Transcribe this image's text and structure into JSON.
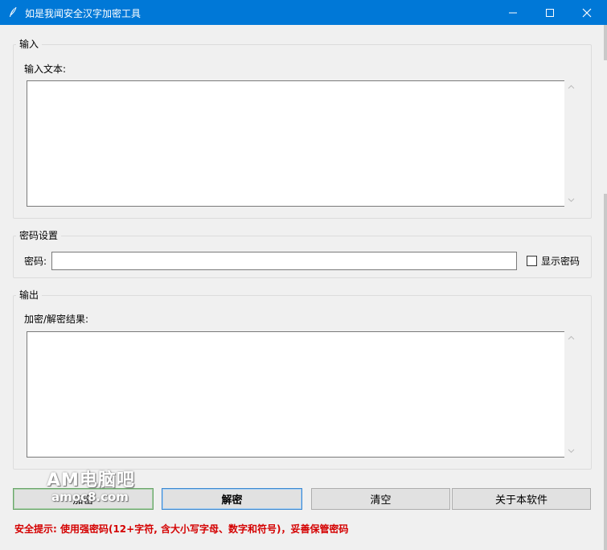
{
  "window": {
    "title": "如是我闻安全汉字加密工具",
    "app_icon": "feather-icon",
    "controls": [
      "minimize-icon",
      "maximize-icon",
      "close-icon"
    ]
  },
  "input_section": {
    "group_title": "输入",
    "field_label": "输入文本:",
    "value": ""
  },
  "password_section": {
    "group_title": "密码设置",
    "field_label": "密码:",
    "value": "",
    "show_password_label": "显示密码",
    "show_password_checked": false
  },
  "output_section": {
    "group_title": "输出",
    "field_label": "加密/解密结果:",
    "value": ""
  },
  "buttons": {
    "encrypt": "加密",
    "decrypt": "解密",
    "clear": "清空",
    "about": "关于本软件"
  },
  "security_tip": "安全提示: 使用强密码(12+字符, 含大小写字母、数字和符号)，妥善保管密码",
  "watermark": {
    "line1": "AM电脑吧",
    "line2": "amoc8.com"
  },
  "colors": {
    "titlebar": "#0078d7",
    "warning_text": "#d40000",
    "encrypt_border": "#6aa56a",
    "decrypt_border": "#3c88d0"
  }
}
